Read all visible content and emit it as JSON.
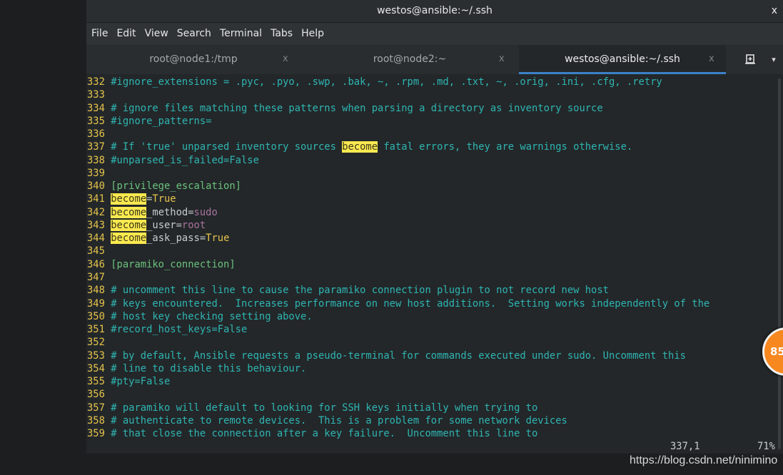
{
  "window": {
    "title": "westos@ansible:~/.ssh",
    "close": "x"
  },
  "menu": [
    "File",
    "Edit",
    "View",
    "Search",
    "Terminal",
    "Tabs",
    "Help"
  ],
  "tabs": [
    {
      "label": "root@node1:/tmp",
      "close": "x",
      "active": false
    },
    {
      "label": "root@node2:~",
      "close": "x",
      "active": false
    },
    {
      "label": "westos@ansible:~/.ssh",
      "close": "x",
      "active": true
    }
  ],
  "tab_menu": "▾",
  "lines": [
    {
      "n": "332",
      "segs": [
        [
          "c",
          "#ignore_extensions = .pyc, .pyo, .swp, .bak, ~, .rpm, .md, .txt, ~, .orig, .ini, .cfg, .retry"
        ]
      ]
    },
    {
      "n": "333",
      "segs": []
    },
    {
      "n": "334",
      "segs": [
        [
          "c",
          "# ignore files matching these patterns when parsing a directory as inventory source"
        ]
      ]
    },
    {
      "n": "335",
      "segs": [
        [
          "c",
          "#ignore_patterns="
        ]
      ]
    },
    {
      "n": "336",
      "segs": []
    },
    {
      "n": "337",
      "segs": [
        [
          "c",
          "# If 'true' unparsed inventory sources "
        ],
        [
          "h",
          "become"
        ],
        [
          "c",
          " fatal errors, they are warnings otherwise."
        ]
      ]
    },
    {
      "n": "338",
      "segs": [
        [
          "c",
          "#unparsed_is_failed=False"
        ]
      ]
    },
    {
      "n": "339",
      "segs": []
    },
    {
      "n": "340",
      "segs": [
        [
          "s",
          "[privilege_escalation]"
        ]
      ]
    },
    {
      "n": "341",
      "segs": [
        [
          "h",
          "become"
        ],
        [
          "k",
          "="
        ],
        [
          "y",
          "True"
        ]
      ]
    },
    {
      "n": "342",
      "segs": [
        [
          "h",
          "become"
        ],
        [
          "k",
          "_method="
        ],
        [
          "p",
          "sudo"
        ]
      ]
    },
    {
      "n": "343",
      "segs": [
        [
          "h",
          "become"
        ],
        [
          "k",
          "_user="
        ],
        [
          "p",
          "root"
        ]
      ]
    },
    {
      "n": "344",
      "segs": [
        [
          "h",
          "become"
        ],
        [
          "k",
          "_ask_pass="
        ],
        [
          "y",
          "True"
        ]
      ]
    },
    {
      "n": "345",
      "segs": []
    },
    {
      "n": "346",
      "segs": [
        [
          "s",
          "[paramiko_connection]"
        ]
      ]
    },
    {
      "n": "347",
      "segs": []
    },
    {
      "n": "348",
      "segs": [
        [
          "c",
          "# uncomment this line to cause the paramiko connection plugin to not record new host"
        ]
      ]
    },
    {
      "n": "349",
      "segs": [
        [
          "c",
          "# keys encountered.  Increases performance on new host additions.  Setting works independently of the"
        ]
      ]
    },
    {
      "n": "350",
      "segs": [
        [
          "c",
          "# host key checking setting above."
        ]
      ]
    },
    {
      "n": "351",
      "segs": [
        [
          "c",
          "#record_host_keys=False"
        ]
      ]
    },
    {
      "n": "352",
      "segs": []
    },
    {
      "n": "353",
      "segs": [
        [
          "c",
          "# by default, Ansible requests a pseudo-terminal for commands executed under sudo. Uncomment this"
        ]
      ]
    },
    {
      "n": "354",
      "segs": [
        [
          "c",
          "# line to disable this behaviour."
        ]
      ]
    },
    {
      "n": "355",
      "segs": [
        [
          "c",
          "#pty=False"
        ]
      ]
    },
    {
      "n": "356",
      "segs": []
    },
    {
      "n": "357",
      "segs": [
        [
          "c",
          "# paramiko will default to looking for SSH keys initially when trying to"
        ]
      ]
    },
    {
      "n": "358",
      "segs": [
        [
          "c",
          "# authenticate to remote devices.  This is a problem for some network devices"
        ]
      ]
    },
    {
      "n": "359",
      "segs": [
        [
          "c",
          "# that close the connection after a key failure.  Uncomment this line to"
        ]
      ]
    }
  ],
  "status": {
    "position": "337,1",
    "percent": "71%"
  },
  "badge": "85",
  "watermark": "https://blog.csdn.net/ninimino",
  "colors": {
    "highlight": "#fce94f",
    "accent": "#3b82c8",
    "comment": "#2fb5b3",
    "line_number": "#e5c34c"
  }
}
